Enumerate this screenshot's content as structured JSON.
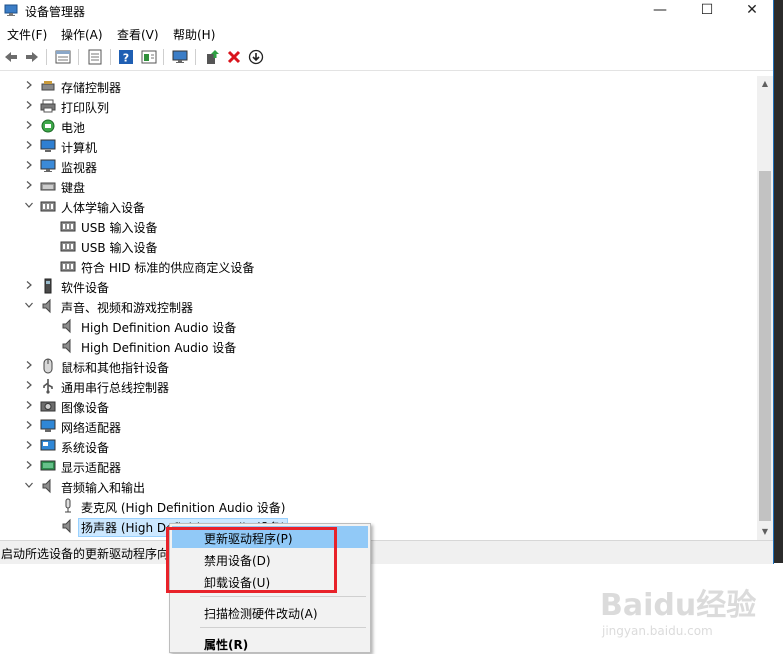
{
  "window": {
    "title": "设备管理器",
    "controls": {
      "minimize": "—",
      "maximize": "☐",
      "close": "✕"
    }
  },
  "menu": [
    "文件(F)",
    "操作(A)",
    "查看(V)",
    "帮助(H)"
  ],
  "toolbar_icons": [
    "back-arrow-icon",
    "forward-arrow-icon",
    "properties-grid-icon",
    "device-list-icon",
    "help-icon",
    "panel-icon",
    "monitor-icon",
    "update-driver-icon",
    "uninstall-x-icon",
    "scan-arrow-icon"
  ],
  "tree": [
    {
      "label": "存储控制器",
      "level": 0,
      "expanded": false,
      "icon": "storage-controller-icon"
    },
    {
      "label": "打印队列",
      "level": 0,
      "expanded": false,
      "icon": "printer-icon"
    },
    {
      "label": "电池",
      "level": 0,
      "expanded": false,
      "icon": "battery-icon"
    },
    {
      "label": "计算机",
      "level": 0,
      "expanded": false,
      "icon": "computer-icon"
    },
    {
      "label": "监视器",
      "level": 0,
      "expanded": false,
      "icon": "monitor-icon"
    },
    {
      "label": "键盘",
      "level": 0,
      "expanded": false,
      "icon": "keyboard-icon"
    },
    {
      "label": "人体学输入设备",
      "level": 0,
      "expanded": true,
      "icon": "hid-icon"
    },
    {
      "label": "USB 输入设备",
      "level": 1,
      "icon": "hid-icon"
    },
    {
      "label": "USB 输入设备",
      "level": 1,
      "icon": "hid-icon"
    },
    {
      "label": "符合 HID 标准的供应商定义设备",
      "level": 1,
      "icon": "hid-icon"
    },
    {
      "label": "软件设备",
      "level": 0,
      "expanded": false,
      "icon": "software-device-icon"
    },
    {
      "label": "声音、视频和游戏控制器",
      "level": 0,
      "expanded": true,
      "icon": "speaker-icon"
    },
    {
      "label": "High Definition Audio 设备",
      "level": 1,
      "icon": "speaker-icon"
    },
    {
      "label": "High Definition Audio 设备",
      "level": 1,
      "icon": "speaker-icon"
    },
    {
      "label": "鼠标和其他指针设备",
      "level": 0,
      "expanded": false,
      "icon": "mouse-icon"
    },
    {
      "label": "通用串行总线控制器",
      "level": 0,
      "expanded": false,
      "icon": "usb-icon"
    },
    {
      "label": "图像设备",
      "level": 0,
      "expanded": false,
      "icon": "camera-icon"
    },
    {
      "label": "网络适配器",
      "level": 0,
      "expanded": false,
      "icon": "network-adapter-icon"
    },
    {
      "label": "系统设备",
      "level": 0,
      "expanded": false,
      "icon": "system-device-icon"
    },
    {
      "label": "显示适配器",
      "level": 0,
      "expanded": false,
      "icon": "display-adapter-icon"
    },
    {
      "label": "音频输入和输出",
      "level": 0,
      "expanded": true,
      "icon": "speaker-icon"
    },
    {
      "label": "麦克风 (High Definition Audio 设备)",
      "level": 1,
      "icon": "microphone-icon"
    },
    {
      "label": "扬声器 (High Definition Audio 设备)",
      "level": 1,
      "icon": "speaker-icon",
      "selected": true
    }
  ],
  "status": "启动所选设备的更新驱动程序向导。",
  "context_menu": [
    {
      "label": "更新驱动程序(P)",
      "hover": true
    },
    {
      "label": "禁用设备(D)"
    },
    {
      "label": "卸载设备(U)"
    },
    {
      "separator": true
    },
    {
      "label": "扫描检测硬件改动(A)"
    },
    {
      "separator": true
    },
    {
      "label": "属性(R)",
      "bold": true
    }
  ],
  "watermark": {
    "text": "Baidu经验",
    "sub": "jingyan.baidu.com"
  },
  "colors": {
    "accent": "#1e6fb8",
    "highlight": "#e8222a",
    "menu_hover": "#91c9f7",
    "selection": "#cce8ff"
  }
}
